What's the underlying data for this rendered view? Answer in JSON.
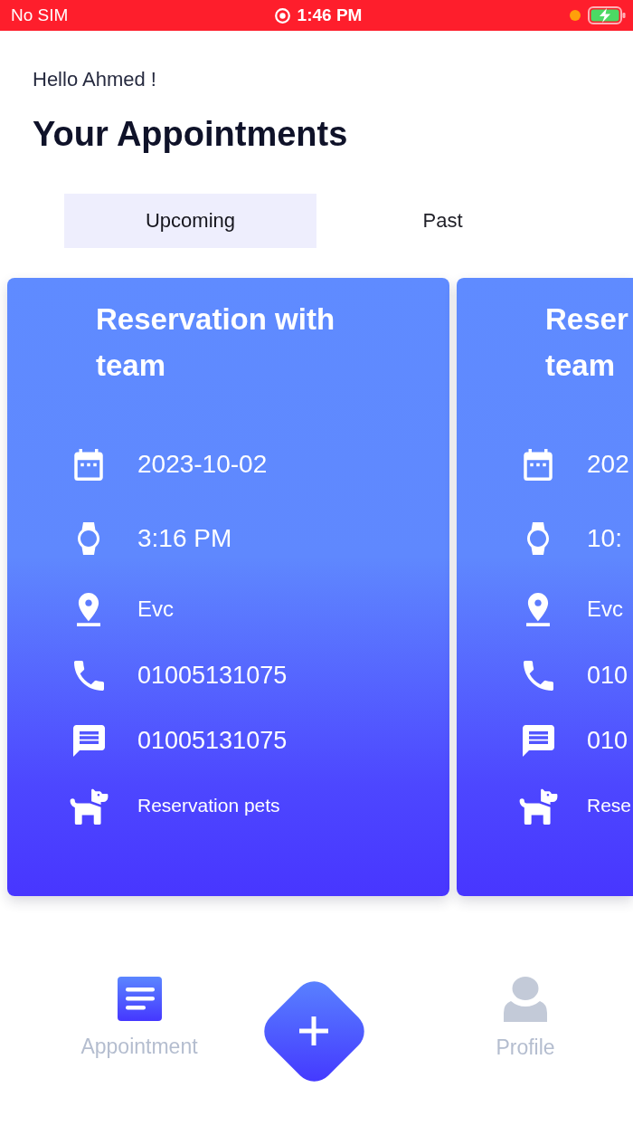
{
  "status_bar": {
    "carrier": "No SIM",
    "time": "1:46 PM"
  },
  "greeting": "Hello Ahmed !",
  "title": "Your Appointments",
  "tabs": [
    {
      "label": "Upcoming",
      "selected": true
    },
    {
      "label": "Past",
      "selected": false
    }
  ],
  "cards": [
    {
      "title_lines": [
        "Reservation with",
        "team"
      ],
      "details": [
        {
          "kind": "date",
          "text": "2023-10-02"
        },
        {
          "kind": "time",
          "text": "3:16 PM"
        },
        {
          "kind": "location",
          "text": "Evc"
        },
        {
          "kind": "phone",
          "text": "01005131075"
        },
        {
          "kind": "message",
          "text": "01005131075"
        },
        {
          "kind": "service",
          "text": "Reservation pets"
        }
      ]
    },
    {
      "title_lines": [
        "Reser",
        "team"
      ],
      "details": [
        {
          "kind": "date",
          "text": "202"
        },
        {
          "kind": "time",
          "text": "10:"
        },
        {
          "kind": "location",
          "text": "Evc"
        },
        {
          "kind": "phone",
          "text": "010"
        },
        {
          "kind": "message",
          "text": "010"
        },
        {
          "kind": "service",
          "text": "Rese"
        }
      ]
    }
  ],
  "bottom_nav": {
    "items": [
      {
        "kind": "appointment",
        "label": "Appointment",
        "selected": true
      },
      {
        "kind": "add"
      },
      {
        "kind": "profile",
        "label": "Profile",
        "selected": false
      }
    ]
  }
}
